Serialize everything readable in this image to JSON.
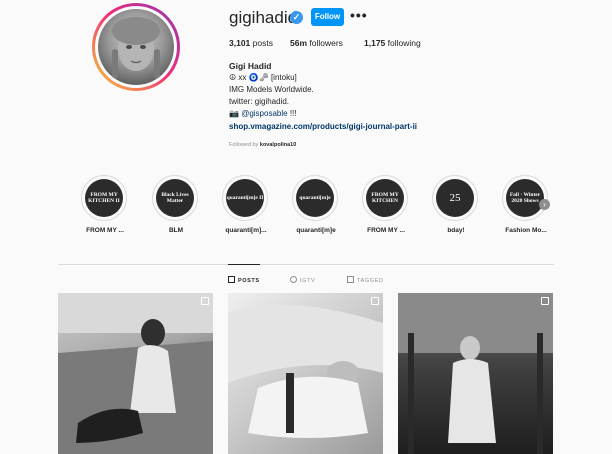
{
  "profile": {
    "username": "gigihadid",
    "verified_mark": "✓",
    "follow_label": "Follow",
    "more_label": "•••",
    "stats": {
      "posts_count": "3,101",
      "posts_label": "posts",
      "followers_count": "56m",
      "followers_label": "followers",
      "following_count": "1,175",
      "following_label": "following"
    },
    "bio": {
      "name": "Gigi Hadid",
      "line1": "☮ xx 🧿🗝 [intoku]",
      "line2": "IMG Models Worldwide.",
      "line3": "twitter: gigihadid.",
      "line4_prefix": "📷",
      "line4_handle": "@gisposable",
      "line4_suffix": "!!!",
      "link": "shop.vmagazine.com/products/gigi-journal-part-ii"
    },
    "followed_by_prefix": "Followed by",
    "followed_by_user": "kovalpolina10"
  },
  "highlights": [
    {
      "cover": "FROM MY KITCHEN II",
      "label": "FROM MY ..."
    },
    {
      "cover": "Black Lives Matter",
      "label": "BLM"
    },
    {
      "cover": "quaranti[m]e II",
      "label": "quaranti[m]..."
    },
    {
      "cover": "quaranti[m]e",
      "label": "quaranti[m]e"
    },
    {
      "cover": "FROM MY KITCHEN",
      "label": "FROM MY ..."
    },
    {
      "cover": "25",
      "label": "bday!"
    },
    {
      "cover": "Fall · Winter 2020 Shows",
      "label": "Fashion Mo..."
    }
  ],
  "highlights_next": "›",
  "tabs": [
    {
      "label": "POSTS",
      "active": true
    },
    {
      "label": "IGTV",
      "active": false
    },
    {
      "label": "TAGGED",
      "active": false
    }
  ],
  "posts": [
    {
      "kind": "photo"
    },
    {
      "kind": "photo"
    },
    {
      "kind": "photo"
    }
  ]
}
